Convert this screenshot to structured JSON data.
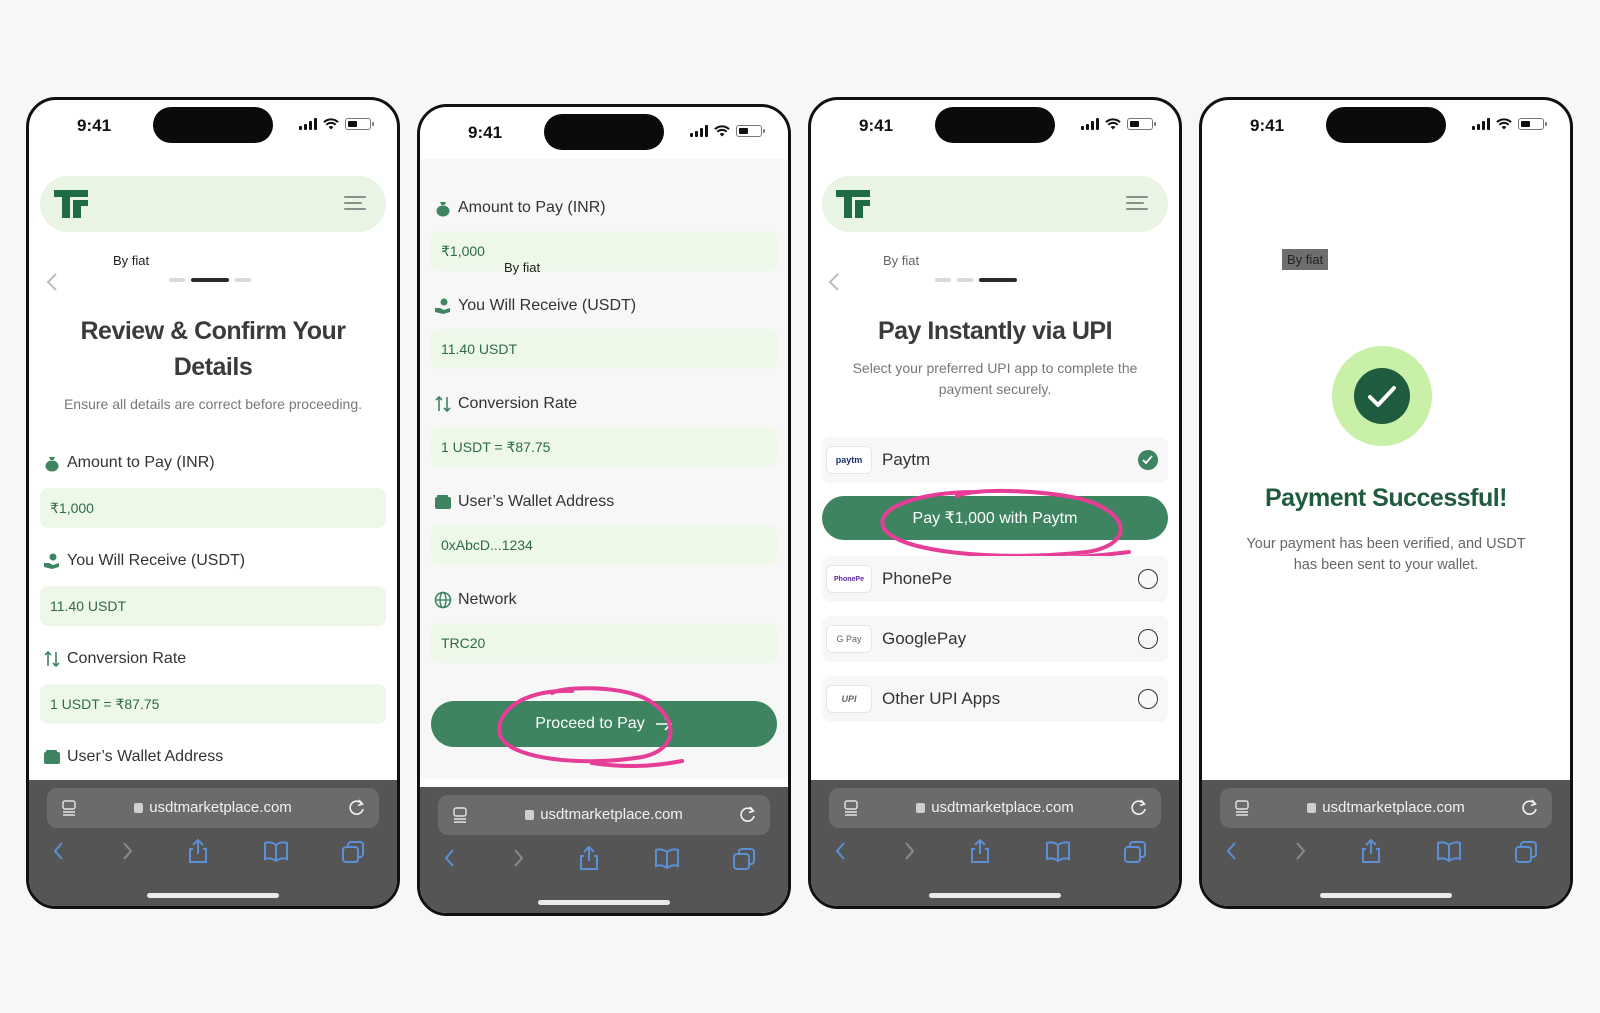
{
  "status": {
    "time": "9:41"
  },
  "browser": {
    "url": "usdtmarketplace.com"
  },
  "by_fiat": "By fiat",
  "screen1": {
    "title": "Review & Confirm Your Details",
    "subtitle": "Ensure all details are correct before proceeding.",
    "fields": [
      {
        "label": "Amount to Pay (INR)",
        "value": "₹1,000",
        "icon": "money-bag-icon"
      },
      {
        "label": "You Will Receive (USDT)",
        "value": "11.40 USDT",
        "icon": "hand-coin-icon"
      },
      {
        "label": "Conversion Rate",
        "value": "1 USDT = ₹87.75",
        "icon": "swap-arrows-icon"
      },
      {
        "label": "User’s Wallet Address",
        "icon": "wallet-icon"
      }
    ]
  },
  "screen2": {
    "fields": [
      {
        "label": "Amount to Pay (INR)",
        "value": "₹1,000",
        "icon": "money-bag-icon"
      },
      {
        "label": "You Will Receive (USDT)",
        "value": "11.40 USDT",
        "icon": "hand-coin-icon"
      },
      {
        "label": "Conversion Rate",
        "value": "1 USDT = ₹87.75",
        "icon": "swap-arrows-icon"
      },
      {
        "label": "User’s Wallet Address",
        "value": "0xAbcD...1234",
        "icon": "wallet-icon"
      },
      {
        "label": "Network",
        "value": "TRC20",
        "icon": "globe-icon"
      }
    ],
    "cta": "Proceed to Pay"
  },
  "screen3": {
    "title": "Pay Instantly via UPI",
    "subtitle": "Select your preferred UPI app to complete the payment securely.",
    "options": [
      {
        "name": "Paytm",
        "logo": "paytm",
        "selected": true
      },
      {
        "name": "PhonePe",
        "logo": "PhonePe",
        "selected": false
      },
      {
        "name": "GooglePay",
        "logo": "G Pay",
        "selected": false
      },
      {
        "name": "Other UPI Apps",
        "logo": "UPI",
        "selected": false
      }
    ],
    "pay_button": "Pay ₹1,000 with Paytm"
  },
  "screen4": {
    "title": "Payment Successful!",
    "subtitle": "Your payment has been verified, and USDT has been sent to your wallet."
  },
  "colors": {
    "primary": "#3f8461",
    "dark_green": "#1f5b3e",
    "field_bg": "#eef8e8",
    "header_bg": "#eaf4e4",
    "highlight": "#e63d97"
  }
}
